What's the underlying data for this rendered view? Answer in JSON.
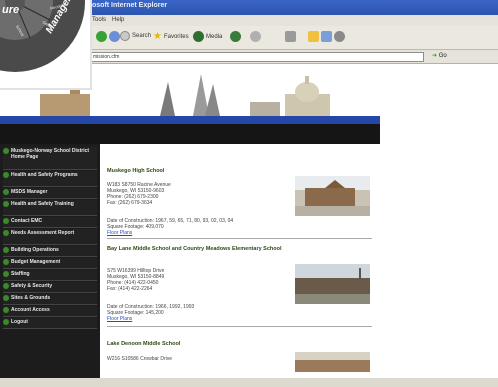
{
  "window": {
    "title": "osoft Internet Explorer"
  },
  "menubar": {
    "items": [
      "Tools",
      "Help"
    ]
  },
  "toolbar": {
    "search": "Search",
    "favorites": "Favorites",
    "media": "Media"
  },
  "addressbar": {
    "url": "mission.cfm",
    "go": "Go"
  },
  "logo": {
    "ring_text_1": "ure",
    "ring_text_2": "Management",
    "wedge_1": "Records",
    "wedge_2": "Safety",
    "wedge_3": "School"
  },
  "nav": {
    "items": [
      "Muskego-Norway School District Home Page",
      "Health and Safety Programs",
      "MSDS Manager",
      "Health and Safety Training",
      "Contact EMC",
      "Needs Assessment Report",
      "Building Operations",
      "Budget Management",
      "Staffing",
      "Safety & Security",
      "Sites & Grounds",
      "Account Access",
      "Logout"
    ]
  },
  "schools": [
    {
      "name": "Muskego High School",
      "lines": [
        "W183 S8750 Racine Avenue",
        "Muskego, WI 53150-9603",
        "Phone: (262) 679-2300",
        "Fax: (262) 679-3634"
      ],
      "construction": "Date of Construction: 1967, 59, 65, 71, 80, 93, 02, 03, 04",
      "footage": "Square Footage: 409,070",
      "link": "Floor Plans"
    },
    {
      "name": "Bay Lane Middle School and Country Meadows Elementary School",
      "lines": [
        "S75 W16399 Hilltop Drive",
        "Muskego, WI 53150-8849",
        "Phone: (414) 422-0450",
        "Fax: (414) 422-2264"
      ],
      "construction": "Date of Construction: 1966, 1992, 1993",
      "footage": "Square Footage: 145,200",
      "link": "Floor Plans"
    },
    {
      "name": "Lake Denoon Middle School",
      "lines": [
        "W216 S10586 Crowbar Drive"
      ],
      "construction": "",
      "footage": "",
      "link": ""
    }
  ],
  "colors": {
    "nav_bg": "#1c1c1c",
    "nav_dot": "#3a8a2a",
    "title_green": "#2c4a16",
    "banner_blue": "#2447a8"
  }
}
